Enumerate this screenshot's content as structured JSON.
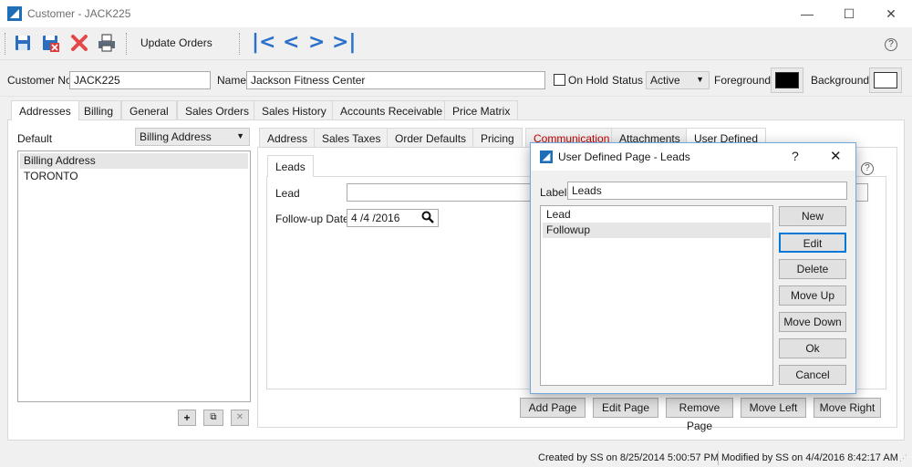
{
  "window": {
    "title": "Customer - JACK225",
    "minimize": "—",
    "maximize": "☐",
    "close": "✕"
  },
  "toolbar": {
    "icons": [
      "save-icon",
      "save-close-icon",
      "delete-icon",
      "print-icon"
    ],
    "update_orders": "Update Orders",
    "nav": {
      "first": "K",
      "prev": "<",
      "next": ">",
      "last": ">I"
    },
    "help": "?"
  },
  "customer": {
    "customer_no_label": "Customer No",
    "customer_no": "JACK225",
    "name_label": "Name",
    "name": "Jackson Fitness Center",
    "on_hold_label": "On Hold",
    "status_label": "Status",
    "status": "Active",
    "foreground_label": "Foreground",
    "foreground_color": "#000000",
    "background_label": "Background",
    "background_color": "#ffffff"
  },
  "main_tabs": [
    "Addresses",
    "Billing",
    "General",
    "Sales Orders",
    "Sales History",
    "Accounts Receivable",
    "Price Matrix"
  ],
  "addresses": {
    "default_label": "Default",
    "default_value": "Billing Address",
    "items": [
      "Billing Address",
      "TORONTO"
    ],
    "add": "+",
    "copy": "⧉",
    "remove": "✕"
  },
  "sub_tabs": [
    "Address",
    "Sales Taxes",
    "Order Defaults",
    "Pricing",
    "Communication",
    "Attachments",
    "User Defined"
  ],
  "sub_tab_colors": {
    "communication": "#c00000"
  },
  "user_defined": {
    "page_tab": "Leads",
    "lead_label": "Lead",
    "lead_value": "",
    "followup_label": "Follow-up Date",
    "followup_value": "4 /4 /2016",
    "help": "?",
    "buttons": [
      "Add Page",
      "Edit Page",
      "Remove Page",
      "Move Left",
      "Move Right"
    ]
  },
  "dialog": {
    "title": "User Defined Page - Leads",
    "help": "?",
    "close": "✕",
    "label_label": "Label",
    "label_value": "Leads",
    "items": [
      "Lead",
      "Followup"
    ],
    "buttons": [
      "New",
      "Edit",
      "Delete",
      "Move Up",
      "Move Down",
      "Ok",
      "Cancel"
    ]
  },
  "status": {
    "created": "Created by SS on 8/25/2014 5:00:57 PM",
    "modified": "Modified by SS on 4/4/2016 8:42:17 AM"
  }
}
